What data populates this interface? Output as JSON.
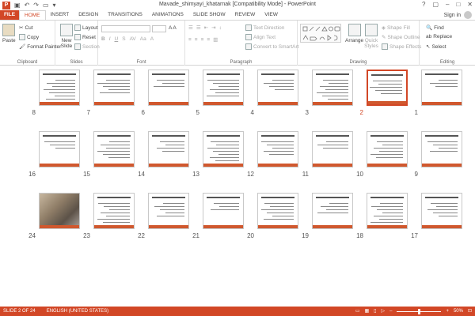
{
  "window": {
    "title": "Mavade_shimyayi_khatarnak [Compatibility Mode] - PowerPoint",
    "controls": [
      "?",
      "▢",
      "–",
      "□",
      "✕"
    ]
  },
  "tabs": [
    "FILE",
    "HOME",
    "INSERT",
    "DESIGN",
    "TRANSITIONS",
    "ANIMATIONS",
    "SLIDE SHOW",
    "REVIEW",
    "VIEW"
  ],
  "signin": "Sign in",
  "ribbon": {
    "clipboard": {
      "paste": "Paste",
      "cut": "Cut",
      "copy": "Copy",
      "format_painter": "Format Painter",
      "label": "Clipboard"
    },
    "slides": {
      "new_slide": "New Slide",
      "layout": "Layout",
      "reset": "Reset",
      "section": "Section",
      "label": "Slides"
    },
    "font": {
      "label": "Font"
    },
    "paragraph": {
      "text_direction": "Text Direction",
      "align_text": "Align Text",
      "convert_smartart": "Convert to SmartArt",
      "label": "Paragraph"
    },
    "drawing": {
      "arrange": "Arrange",
      "quick_styles": "Quick Styles",
      "shape_fill": "Shape Fill",
      "shape_outline": "Shape Outline",
      "shape_effects": "Shape Effects",
      "label": "Drawing"
    },
    "editing": {
      "find": "Find",
      "replace": "Replace",
      "select": "Select",
      "label": "Editing"
    }
  },
  "slides": [
    {
      "n": "1"
    },
    {
      "n": "2",
      "selected": true
    },
    {
      "n": "3"
    },
    {
      "n": "4"
    },
    {
      "n": "5"
    },
    {
      "n": "6"
    },
    {
      "n": "7"
    },
    {
      "n": "8"
    },
    {
      "n": "9"
    },
    {
      "n": "10"
    },
    {
      "n": "11"
    },
    {
      "n": "12"
    },
    {
      "n": "13"
    },
    {
      "n": "14"
    },
    {
      "n": "15"
    },
    {
      "n": "16"
    },
    {
      "n": "17"
    },
    {
      "n": "18"
    },
    {
      "n": "19"
    },
    {
      "n": "20"
    },
    {
      "n": "21"
    },
    {
      "n": "22"
    },
    {
      "n": "23"
    },
    {
      "n": "24",
      "photo": true
    }
  ],
  "status": {
    "slide_of": "SLIDE 2 OF 24",
    "language": "ENGLISH (UNITED STATES)",
    "zoom": "50%",
    "zoom_fraction": 0.5
  },
  "colors": {
    "accent": "#d24726",
    "slide_bar": "#d0582e"
  }
}
